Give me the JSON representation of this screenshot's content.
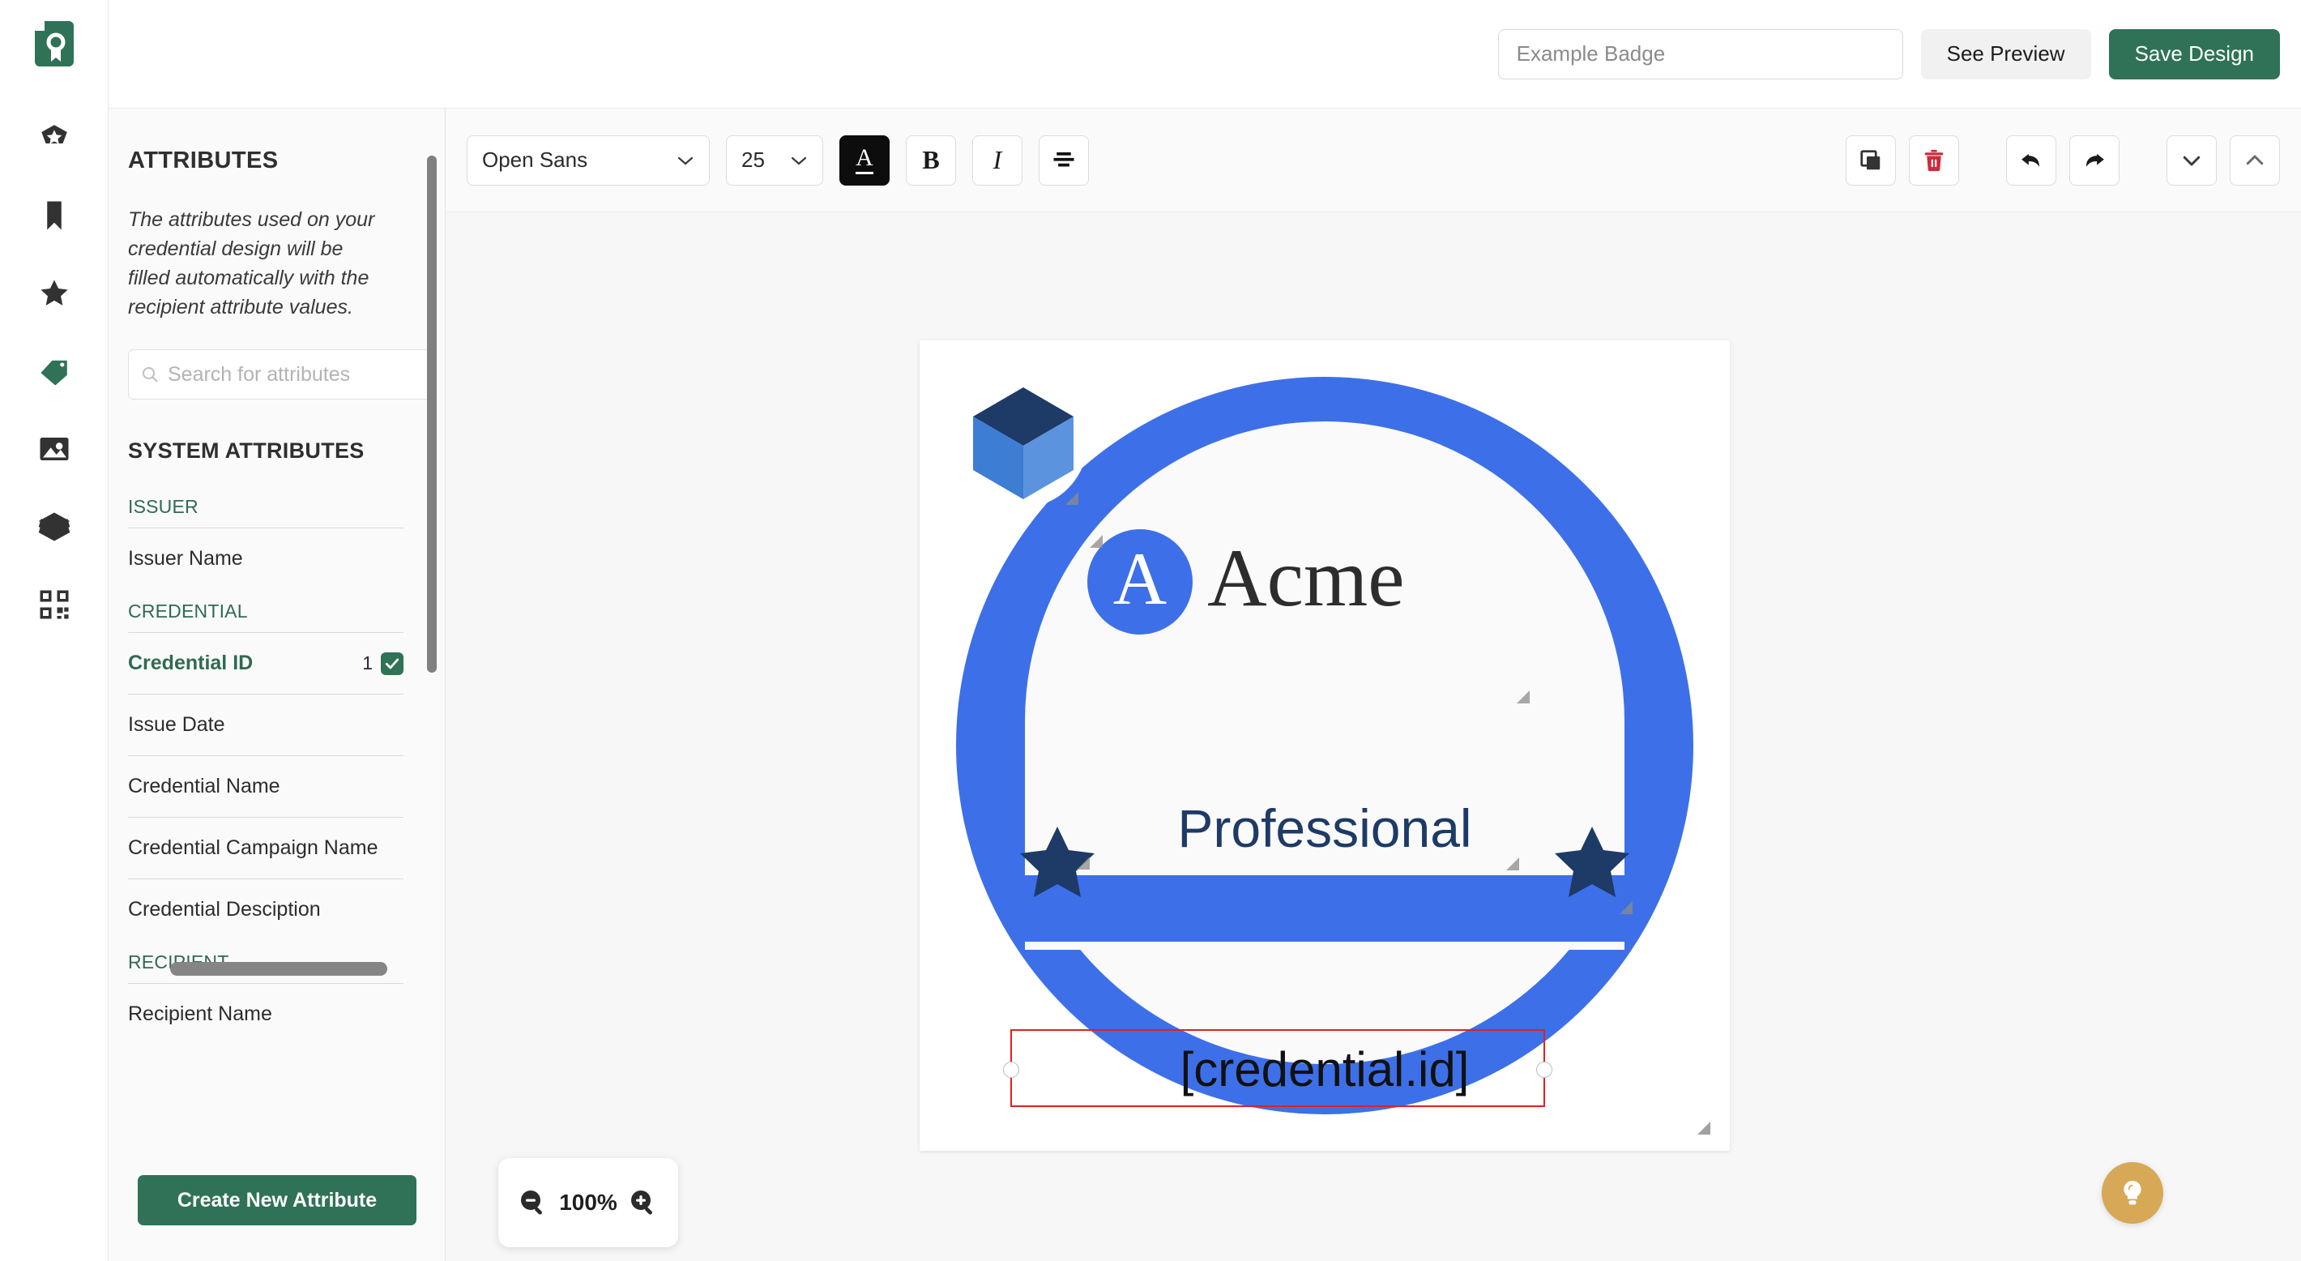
{
  "app": {
    "logo_icon": "certificate-logo-icon",
    "accent_green": "#2f7257",
    "badge_blue": "#3d70e8",
    "badge_navy": "#1e3a66",
    "danger_red": "#cf2b3c",
    "selection_red": "#e02020",
    "help_gold": "#d7a855"
  },
  "rail": {
    "items": [
      {
        "name": "sidebar-item-badges",
        "icon": "badge-star-hexagon-icon",
        "active": false
      },
      {
        "name": "sidebar-item-bookmarks",
        "icon": "bookmark-icon",
        "active": false
      },
      {
        "name": "sidebar-item-favorites",
        "icon": "star-icon",
        "active": false
      },
      {
        "name": "sidebar-item-attributes",
        "icon": "tag-icon",
        "active": true
      },
      {
        "name": "sidebar-item-images",
        "icon": "image-icon",
        "active": false
      },
      {
        "name": "sidebar-item-layers",
        "icon": "layers-icon",
        "active": false
      },
      {
        "name": "sidebar-item-qrcode",
        "icon": "qr-code-icon",
        "active": false
      }
    ]
  },
  "header": {
    "design_name_value": "",
    "design_name_placeholder": "Example Badge",
    "see_preview_label": "See Preview",
    "save_design_label": "Save Design"
  },
  "attributes_panel": {
    "title": "ATTRIBUTES",
    "description": "The attributes used on your credential design will be filled automatically with the recipient attribute values.",
    "search_placeholder": "Search for attributes",
    "search_value": "",
    "search_icon": "search-icon",
    "system_title": "SYSTEM ATTRIBUTES",
    "groups": [
      {
        "label": "ISSUER",
        "items": [
          {
            "label": "Issuer Name",
            "count": "",
            "checked": false,
            "selected": false
          }
        ]
      },
      {
        "label": "CREDENTIAL",
        "items": [
          {
            "label": "Credential ID",
            "count": "1",
            "checked": true,
            "selected": true
          },
          {
            "label": "Issue Date",
            "count": "",
            "checked": false,
            "selected": false
          },
          {
            "label": "Credential Name",
            "count": "",
            "checked": false,
            "selected": false
          },
          {
            "label": "Credential Campaign Name",
            "count": "",
            "checked": false,
            "selected": false
          },
          {
            "label": "Credential Desciption",
            "count": "",
            "checked": false,
            "selected": false
          }
        ]
      },
      {
        "label": "RECIPIENT",
        "items": [
          {
            "label": "Recipient Name",
            "count": "",
            "checked": false,
            "selected": false
          }
        ]
      }
    ],
    "create_button_label": "Create New Attribute"
  },
  "toolbar": {
    "font_family_value": "Open Sans",
    "font_size_value": "25",
    "text_color_label": "A",
    "bold_label": "B",
    "italic_label": "I",
    "align_icon": "align-center-icon",
    "duplicate_icon": "duplicate-icon",
    "delete_icon": "trash-icon",
    "undo_icon": "undo-icon",
    "redo_icon": "redo-icon",
    "send_backward_icon": "chevron-down-icon",
    "bring_forward_icon": "chevron-up-icon"
  },
  "canvas": {
    "zoom_level": "100%",
    "zoom_out_icon": "zoom-out-icon",
    "zoom_in_icon": "zoom-in-icon",
    "resize_grip_icon": "resize-grip-icon",
    "badge": {
      "cube_logo_icon": "cube-3d-icon",
      "monogram": "A",
      "issuer_name": "Acme",
      "level_text": "Professional",
      "level_star_icon": "star-icon",
      "credential_id_text": "[credential.id]"
    },
    "selected_element": {
      "name": "credential-id-text",
      "text": "[credential.id]",
      "handle_icon": "resize-handle-icon"
    }
  },
  "help": {
    "icon": "lightbulb-icon"
  }
}
